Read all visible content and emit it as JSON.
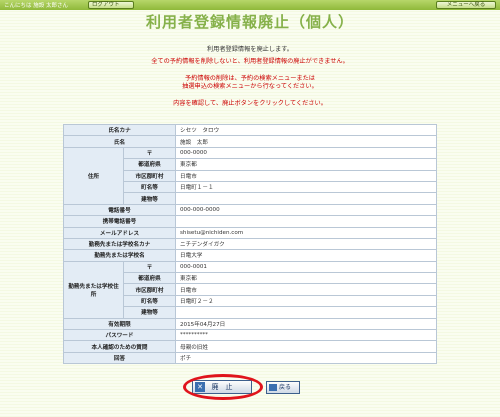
{
  "header": {
    "greeting": "こんにちは 施設 太郎さん",
    "logout_label": "ログアウト",
    "menu_label": "メニューへ戻る"
  },
  "page": {
    "title": "利用者登録情報廃止（個人）"
  },
  "messages": {
    "m1": "利用者登録情報を廃止します。",
    "m2": "全ての予約情報を削除しないと、利用者登録情報の廃止ができません。",
    "m3": "予約情報の削除は、予約の検索メニューまたは",
    "m4": "抽選申込の検索メニューから行なってください。",
    "m5": "内容を確認して、廃止ボタンをクリックしてください。"
  },
  "table": {
    "kana_label": "氏名カナ",
    "kana": "シセツ　タロウ",
    "name_label": "氏名",
    "name": "施設　太郎",
    "address_label": "住所",
    "zip_label": "〒",
    "zip": "000-0000",
    "pref_label": "都道府県",
    "pref": "東京都",
    "city_label": "市区郡町村",
    "city": "日電市",
    "street_label": "町名等",
    "street": "日電町１－１",
    "bldg_label": "建物等",
    "bldg": "",
    "phone_label": "電話番号",
    "phone": "000-000-0000",
    "mobile_label": "携帯電話番号",
    "mobile": "",
    "email_label": "メールアドレス",
    "email": "shisetu@nichiden.com",
    "work_kana_label": "勤務先または学校名カナ",
    "work_kana": "ニチデンダイガク",
    "work_name_label": "勤務先または学校名",
    "work_name": "日電大学",
    "work_addr_label": "勤務先または学校住所",
    "w_zip": "000-0001",
    "w_pref": "東京都",
    "w_city": "日電市",
    "w_street": "日電町２－２",
    "w_bldg": "",
    "expiry_label": "有効期限",
    "expiry": "2015年04月27日",
    "password_label": "パスワード",
    "password": "**********",
    "question_label": "本人確認のための質問",
    "question": "母親の旧姓",
    "answer_label": "回答",
    "answer": "ポチ"
  },
  "buttons": {
    "delete_label": "廃　止",
    "back_label": "戻る"
  },
  "colors": {
    "title": "#86b14a",
    "warning": "#cc0000",
    "highlight": "#e0141c",
    "label_bg": "#e3ecf5"
  }
}
